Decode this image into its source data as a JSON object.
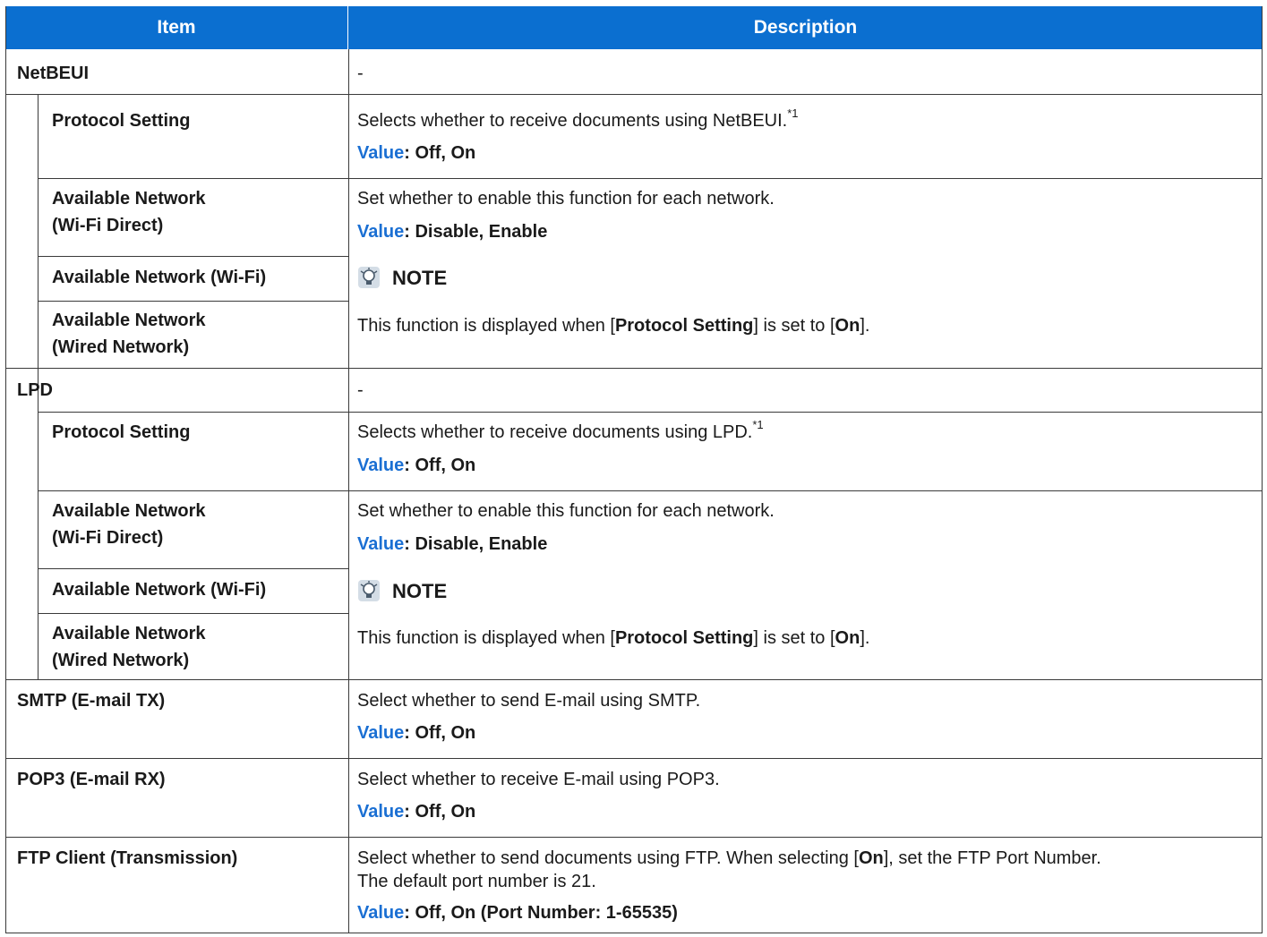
{
  "header": {
    "item": "Item",
    "description": "Description"
  },
  "value_label": "Value",
  "note_label": "NOTE",
  "rows": {
    "netbeui": {
      "item": "NetBEUI",
      "description": "-",
      "protocol": {
        "item": "Protocol Setting",
        "desc_text": "Selects whether to receive documents using NetBEUI.",
        "footnote": "*1",
        "value": ": Off, On"
      },
      "avail_direct": {
        "line1": "Available Network",
        "line2": "(Wi-Fi Direct)"
      },
      "avail_wifi": {
        "item": "Available Network (Wi-Fi)"
      },
      "avail_wired": {
        "line1": "Available Network",
        "line2": "(Wired Network)"
      },
      "avail_desc": "Set whether to enable this function for each network.",
      "avail_value": ": Disable, Enable",
      "note_pre": "This function is displayed when [",
      "note_bold1": "Protocol Setting",
      "note_mid": "] is set to [",
      "note_bold2": "On",
      "note_post": "]."
    },
    "lpd": {
      "item": "LPD",
      "description": "-",
      "protocol": {
        "item": "Protocol Setting",
        "desc_text": "Selects whether to receive documents using LPD.",
        "footnote": "*1",
        "value": ": Off, On"
      },
      "avail_direct": {
        "line1": "Available Network",
        "line2": "(Wi-Fi Direct)"
      },
      "avail_wifi": {
        "item": "Available Network (Wi-Fi)"
      },
      "avail_wired": {
        "line1": "Available Network",
        "line2": "(Wired Network)"
      },
      "avail_desc": "Set whether to enable this function for each network.",
      "avail_value": ": Disable, Enable",
      "note_pre": "This function is displayed when [",
      "note_bold1": "Protocol Setting",
      "note_mid": "] is set to [",
      "note_bold2": "On",
      "note_post": "]."
    },
    "smtp": {
      "item": "SMTP (E-mail TX)",
      "desc": "Select whether to send E-mail using SMTP.",
      "value": ": Off, On"
    },
    "pop3": {
      "item": "POP3 (E-mail RX)",
      "desc": "Select whether to receive E-mail using POP3.",
      "value": ": Off, On"
    },
    "ftp": {
      "item": "FTP Client (Transmission)",
      "desc_pre": "Select whether to send documents using FTP. When selecting [",
      "desc_bold": "On",
      "desc_post": "], set the FTP Port Number.",
      "desc_line2": "The default port number is 21.",
      "value": ": Off, On (Port Number: 1-65535)"
    }
  }
}
